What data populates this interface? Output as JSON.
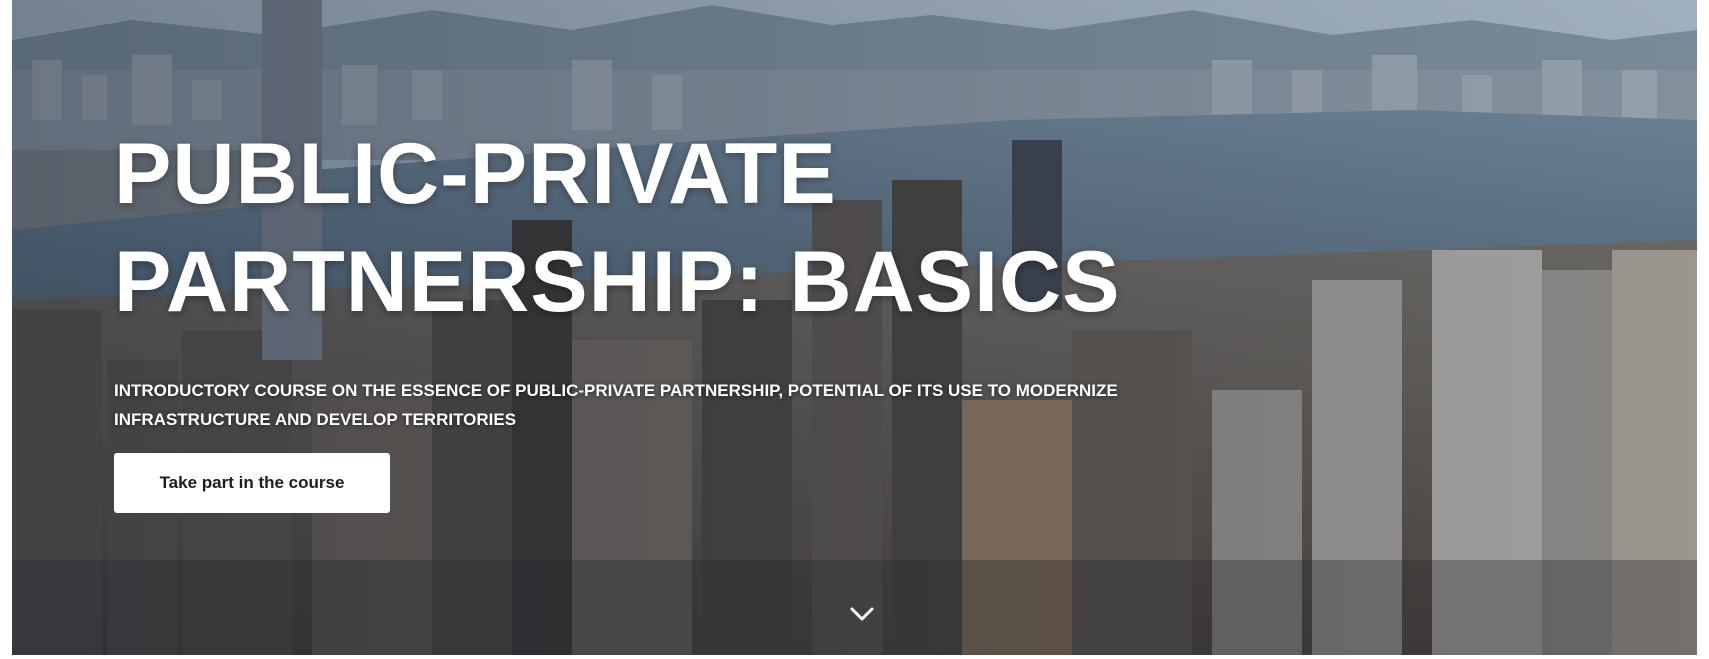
{
  "hero": {
    "title_line1": "PUBLIC-PRIVATE",
    "title_line2": "PARTNERSHIP: BASICS",
    "subtitle": "INTRODUCTORY COURSE ON THE ESSENCE OF PUBLIC-PRIVATE PARTNERSHIP, POTENTIAL OF ITS USE TO MODERNIZE INFRASTRUCTURE AND DEVELOP TERRITORIES",
    "cta_label": "Take part in the course",
    "background_image": "hong-kong-skyline-photo",
    "scroll_icon": "chevron-down-icon"
  },
  "colors": {
    "text": "#ffffff",
    "button_bg": "#ffffff",
    "button_text": "#1d1d1d"
  }
}
